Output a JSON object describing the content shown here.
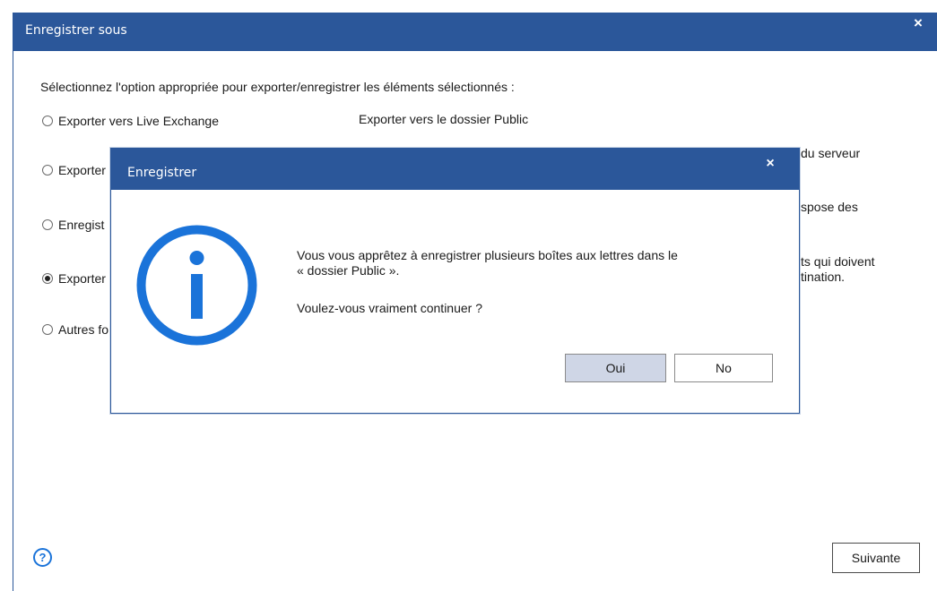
{
  "window": {
    "title": "Enregistrer sous",
    "close_label": "×"
  },
  "instruction": "Sélectionnez l'option appropriée pour exporter/enregistrer les éléments sélectionnés :",
  "options": [
    {
      "label": "Exporter vers Live Exchange",
      "checked": false
    },
    {
      "label": "Exporter",
      "checked": false
    },
    {
      "label": "Enregist",
      "checked": false
    },
    {
      "label": "Exporter",
      "checked": true
    },
    {
      "label": "Autres fo",
      "checked": false
    }
  ],
  "descriptions": {
    "public_folder": "Exporter vers le dossier Public",
    "server_fragment": "du serveur",
    "dispose_fragment": "spose des",
    "items_line1": "ts qui doivent",
    "items_line2": "tination."
  },
  "footer": {
    "help_label": "?",
    "next_label": "Suivante"
  },
  "modal": {
    "title": "Enregistrer",
    "close_label": "×",
    "message_line1": "Vous vous apprêtez à enregistrer plusieurs boîtes aux lettres dans le",
    "message_line2": "« dossier Public ».",
    "question": "Voulez-vous vraiment continuer ?",
    "yes_label": "Oui",
    "no_label": "No",
    "icon": "info-icon",
    "icon_color": "#1a73d9"
  },
  "colors": {
    "titlebar": "#2b579a",
    "accent": "#1a73d9"
  }
}
